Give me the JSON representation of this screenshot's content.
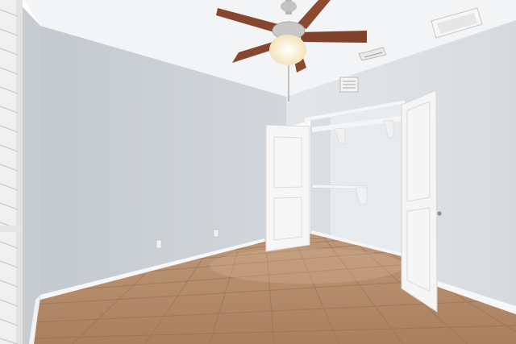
{
  "scene": {
    "colors": {
      "ceiling": "#f4f5f6",
      "wall_left": "#cdd2d7",
      "wall_right": "#dfe3e6",
      "closet_interior": "#e9ecee",
      "floor": "#b48a67",
      "floor_grout": "#9c7456",
      "baseboard": "#f7f7f7",
      "door": "#f5f5f5",
      "shutter": "#f2f2f2",
      "fan_blade": "#8a4a33",
      "fan_metal": "#b9b9b9",
      "fan_light": "#fff4d6"
    }
  }
}
